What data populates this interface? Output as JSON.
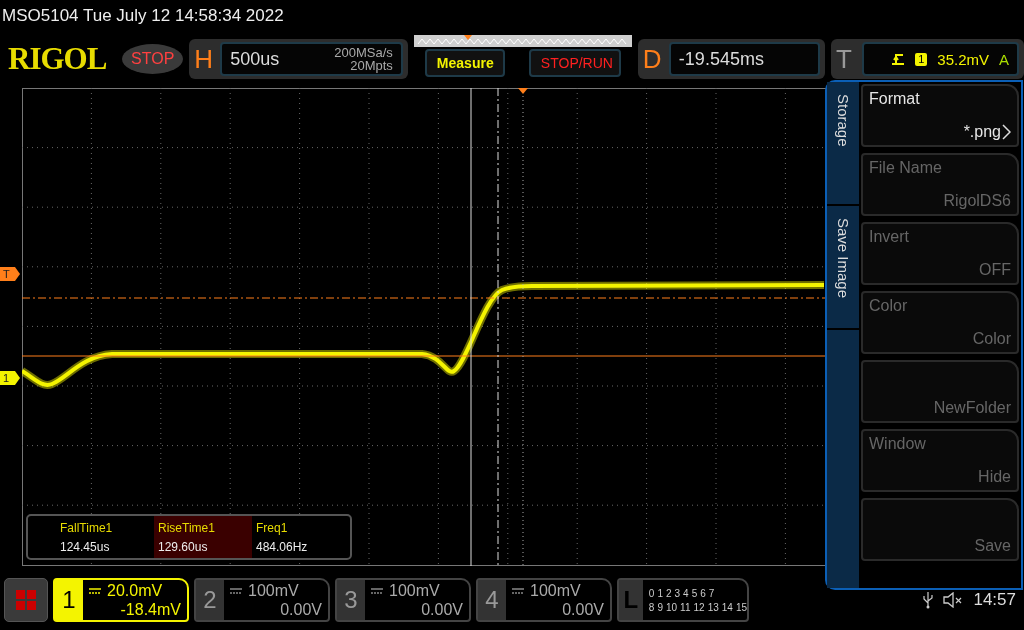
{
  "title": "MSO5104  Tue July 12 14:58:34 2022",
  "logo": "RIGOL",
  "run_state": "STOP",
  "horizontal": {
    "label": "H",
    "timebase": "500us",
    "sample_rate": "200MSa/s",
    "memory_depth": "20Mpts"
  },
  "measure_button": "Measure",
  "stop_run_button": "STOP/RUN",
  "delay": {
    "label": "D",
    "value": "-19.545ms"
  },
  "trigger": {
    "label": "T",
    "source": "1",
    "level": "35.2mV",
    "mode": "A"
  },
  "markers": [
    {
      "label": "T",
      "kind": "trigger"
    },
    {
      "label": "1",
      "kind": "channel"
    }
  ],
  "measurements": [
    {
      "name": "FallTime1",
      "value": "124.45us",
      "selected": false
    },
    {
      "name": "RiseTime1",
      "value": "129.60us",
      "selected": true
    },
    {
      "name": "Freq1",
      "value": "484.06Hz",
      "selected": false
    }
  ],
  "menu": {
    "tabs": [
      "Storage",
      "Save Image"
    ],
    "items": [
      {
        "label": "Format",
        "value": "*.png",
        "disabled": false,
        "submenu": true
      },
      {
        "label": "File Name",
        "value": "RigolDS6",
        "disabled": true,
        "submenu": false
      },
      {
        "label": "Invert",
        "value": "OFF",
        "disabled": true,
        "submenu": false
      },
      {
        "label": "Color",
        "value": "Color",
        "disabled": true,
        "submenu": false
      },
      {
        "value": "NewFolder",
        "disabled": true,
        "submenu": false
      },
      {
        "label": "Window",
        "value": "Hide",
        "disabled": true,
        "submenu": false
      },
      {
        "value": "Save",
        "disabled": true,
        "submenu": false
      }
    ]
  },
  "channels": [
    {
      "number": "1",
      "scale": "20.0mV",
      "offset": "-18.4mV",
      "on": true
    },
    {
      "number": "2",
      "scale": "100mV",
      "offset": "0.00V",
      "on": false
    },
    {
      "number": "3",
      "scale": "100mV",
      "offset": "0.00V",
      "on": false
    },
    {
      "number": "4",
      "scale": "100mV",
      "offset": "0.00V",
      "on": false
    }
  ],
  "logic": {
    "label": "L",
    "row_1": [
      "0",
      "1",
      "2",
      "3",
      "4",
      "5",
      "6",
      "7"
    ],
    "row_2": [
      "8",
      "9",
      "10",
      "11",
      "12",
      "13",
      "14",
      "15"
    ]
  },
  "status": {
    "clock": "14:57"
  }
}
